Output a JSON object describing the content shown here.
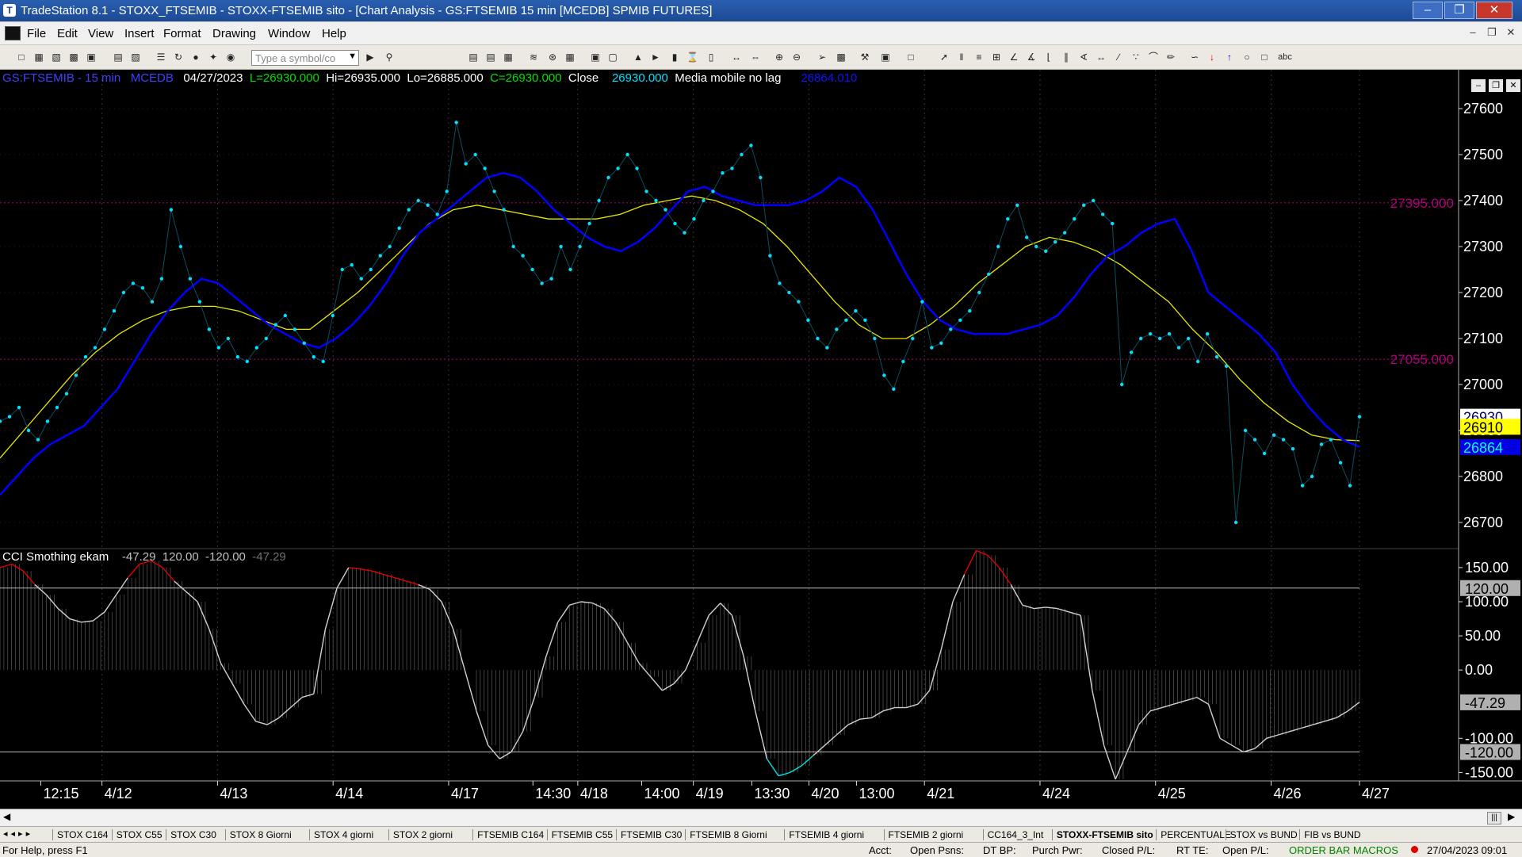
{
  "window": {
    "title": "TradeStation 8.1 - STOXX_FTSEMIB - STOXX-FTSEMIB sito - [Chart Analysis - GS:FTSEMIB  15 min  [MCEDB] SPMIB FUTURES]"
  },
  "menu": [
    "File",
    "Edit",
    "View",
    "Insert",
    "Format",
    "Drawing",
    "Window",
    "Help"
  ],
  "toolbar": {
    "symbol_placeholder": "Type a symbol/co",
    "text_tool_label": "abc"
  },
  "chart_header": {
    "symbol": "GS:FTSEMIB - 15 min",
    "source": "MCEDB",
    "date": "04/27/2023",
    "last": "L=26930.000",
    "high": "Hi=26935.000",
    "low": "Lo=26885.000",
    "close_eq": "C=26930.000",
    "close_label": "Close",
    "close_value": "26930.000",
    "ma_label": "Media mobile no lag",
    "ma_value": "26864.010"
  },
  "indicator_header": {
    "name": "CCI Smothing ekam",
    "value": "-47.29",
    "upper": "120.00",
    "lower": "-120.00",
    "value2": "-47.29"
  },
  "price_axis": {
    "ticks": [
      27600,
      27500,
      27400,
      27300,
      27200,
      27100,
      27000,
      26900,
      26800,
      26700
    ],
    "tick_labels": [
      "27600",
      "27500",
      "27400",
      "27300",
      "27200",
      "27100",
      "27000",
      "26900",
      "26800",
      "26700"
    ],
    "min": 26650,
    "max": 27650,
    "level_high": {
      "value": 27395,
      "label": "27395.000"
    },
    "level_low": {
      "value": 27055,
      "label": "27055.000"
    },
    "badges": [
      {
        "label": "26930",
        "value": 26930,
        "bg": "#ffffff",
        "fg": "#000080"
      },
      {
        "label": "26910",
        "value": 26908,
        "bg": "#ffff00",
        "fg": "#000000"
      },
      {
        "label": "26864",
        "value": 26864,
        "bg": "#0000e0",
        "fg": "#00ffff"
      }
    ]
  },
  "cci_axis": {
    "ticks": [
      150,
      100,
      50,
      0,
      -100,
      -150
    ],
    "tick_labels": [
      "150.00",
      "100.00",
      "50.00",
      "0.00",
      "-100.00",
      "-150.00"
    ],
    "min": -160,
    "max": 165,
    "upper_band": {
      "value": 120,
      "label": "120.00"
    },
    "lower_band": {
      "value": -120,
      "label": "-120.00"
    },
    "current": {
      "value": -47.29,
      "label": "-47.29"
    }
  },
  "time_axis": [
    {
      "label": "12:15",
      "t": 0.03
    },
    {
      "label": "4/12",
      "t": 0.075
    },
    {
      "label": "4/13",
      "t": 0.16
    },
    {
      "label": "4/14",
      "t": 0.245
    },
    {
      "label": "4/17",
      "t": 0.33
    },
    {
      "label": "14:30",
      "t": 0.392
    },
    {
      "label": "4/18",
      "t": 0.425
    },
    {
      "label": "14:00",
      "t": 0.472
    },
    {
      "label": "4/19",
      "t": 0.51
    },
    {
      "label": "13:30",
      "t": 0.553
    },
    {
      "label": "4/20",
      "t": 0.595
    },
    {
      "label": "13:00",
      "t": 0.63
    },
    {
      "label": "4/21",
      "t": 0.68
    },
    {
      "label": "4/24",
      "t": 0.765
    },
    {
      "label": "4/25",
      "t": 0.85
    },
    {
      "label": "4/26",
      "t": 0.935
    },
    {
      "label": "4/27",
      "t": 1.0
    }
  ],
  "chart_data": {
    "type": "line",
    "price_close": [
      26920,
      26930,
      26950,
      26900,
      26880,
      26920,
      26950,
      26980,
      27020,
      27060,
      27080,
      27120,
      27160,
      27200,
      27220,
      27210,
      27180,
      27230,
      27380,
      27300,
      27230,
      27180,
      27120,
      27080,
      27100,
      27060,
      27050,
      27080,
      27100,
      27130,
      27150,
      27120,
      27090,
      27060,
      27050,
      27150,
      27250,
      27260,
      27230,
      27250,
      27280,
      27300,
      27340,
      27380,
      27400,
      27390,
      27370,
      27420,
      27570,
      27480,
      27500,
      27470,
      27420,
      27380,
      27300,
      27280,
      27250,
      27220,
      27230,
      27300,
      27250,
      27300,
      27350,
      27400,
      27450,
      27470,
      27500,
      27470,
      27420,
      27400,
      27380,
      27350,
      27330,
      27360,
      27400,
      27420,
      27460,
      27470,
      27500,
      27520,
      27450,
      27280,
      27220,
      27200,
      27180,
      27140,
      27100,
      27080,
      27120,
      27140,
      27160,
      27140,
      27100,
      27020,
      26990,
      27050,
      27100,
      27180,
      27080,
      27090,
      27120,
      27140,
      27160,
      27200,
      27240,
      27300,
      27360,
      27390,
      27320,
      27300,
      27290,
      27310,
      27330,
      27360,
      27390,
      27400,
      27370,
      27350,
      27000,
      27070,
      27100,
      27110,
      27100,
      27110,
      27080,
      27100,
      27050,
      27110,
      27060,
      27040,
      26700,
      26900,
      26880,
      26850,
      26890,
      26880,
      26860,
      26780,
      26800,
      26870,
      26880,
      26830,
      26780,
      26930
    ],
    "ma_blue": [
      26760,
      26800,
      26840,
      26870,
      26890,
      26910,
      26950,
      26990,
      27050,
      27110,
      27160,
      27200,
      27230,
      27220,
      27190,
      27160,
      27130,
      27110,
      27090,
      27080,
      27100,
      27130,
      27170,
      27220,
      27280,
      27330,
      27360,
      27390,
      27420,
      27450,
      27460,
      27450,
      27420,
      27380,
      27350,
      27320,
      27300,
      27290,
      27310,
      27340,
      27380,
      27420,
      27430,
      27410,
      27400,
      27390,
      27390,
      27390,
      27400,
      27420,
      27450,
      27430,
      27380,
      27310,
      27240,
      27180,
      27140,
      27120,
      27110,
      27110,
      27110,
      27120,
      27130,
      27150,
      27190,
      27240,
      27280,
      27300,
      27330,
      27350,
      27360,
      27290,
      27200,
      27170,
      27140,
      27110,
      27070,
      27000,
      26950,
      26910,
      26880,
      26864
    ],
    "ma_yellow": [
      26840,
      26900,
      26960,
      27020,
      27070,
      27110,
      27140,
      27160,
      27170,
      27170,
      27160,
      27140,
      27120,
      27120,
      27160,
      27200,
      27250,
      27300,
      27350,
      27380,
      27390,
      27380,
      27370,
      27360,
      27360,
      27360,
      27370,
      27390,
      27400,
      27410,
      27400,
      27380,
      27350,
      27300,
      27240,
      27180,
      27130,
      27100,
      27100,
      27130,
      27170,
      27220,
      27260,
      27300,
      27320,
      27310,
      27290,
      27260,
      27220,
      27180,
      27120,
      27070,
      27010,
      26960,
      26920,
      26890,
      26880,
      26878
    ],
    "cci": [
      150,
      155,
      145,
      125,
      110,
      90,
      75,
      70,
      72,
      85,
      110,
      135,
      155,
      160,
      150,
      130,
      115,
      100,
      60,
      10,
      -20,
      -50,
      -75,
      -80,
      -70,
      -55,
      -40,
      -35,
      60,
      120,
      150,
      148,
      145,
      140,
      135,
      130,
      125,
      118,
      100,
      60,
      0,
      -60,
      -110,
      -130,
      -120,
      -90,
      -40,
      20,
      70,
      95,
      100,
      98,
      90,
      70,
      40,
      10,
      -10,
      -30,
      -20,
      0,
      40,
      80,
      98,
      80,
      20,
      -60,
      -130,
      -155,
      -150,
      -140,
      -125,
      -110,
      -95,
      -80,
      -72,
      -70,
      -60,
      -55,
      -55,
      -50,
      -30,
      30,
      100,
      140,
      175,
      168,
      150,
      125,
      95,
      90,
      92,
      90,
      85,
      80,
      -30,
      -110,
      -160,
      -120,
      -80,
      -60,
      -55,
      -50,
      -45,
      -40,
      -50,
      -100,
      -110,
      -120,
      -115,
      -100,
      -95,
      -90,
      -85,
      -80,
      -75,
      -70,
      -60,
      -47
    ]
  },
  "tabs": [
    "STOX C164",
    "STOX C55",
    "STOX  C30",
    "STOX  8 Giorni",
    "STOX 4 giorni",
    "STOX  2 giorni",
    "FTSEMIB C164",
    "FTSEMIB C55",
    "FTSEMIB C30",
    "FTSEMIB  8 Giorni",
    "FTSEMIB  4 giorni",
    "FTSEMIB  2 giorni",
    "CC164_3_Int",
    "STOXX-FTSEMIB sito",
    "PERCENTUALE",
    "STOX vs BUND",
    "FIB vs BUND"
  ],
  "active_tab": "STOXX-FTSEMIB sito",
  "status": {
    "help": "For Help, press F1",
    "acct": "Acct:",
    "open_psns": "Open Psns:",
    "dt_bp": "DT BP:",
    "purch_pwr": "Purch Pwr:",
    "closed_pl": "Closed P/L:",
    "rt_te": "RT TE:",
    "open_pl": "Open P/L:",
    "mode": "ORDER BAR  MACROS",
    "datetime": "27/04/2023 09:01"
  },
  "colors": {
    "price_dots": "#00e0ff",
    "ma_blue": "#0000ff",
    "ma_yellow": "#e8e800",
    "level": "#b0007a",
    "cci_line": "#d0d0d0",
    "cci_high": "#e00000",
    "cci_low": "#00e0e0"
  }
}
